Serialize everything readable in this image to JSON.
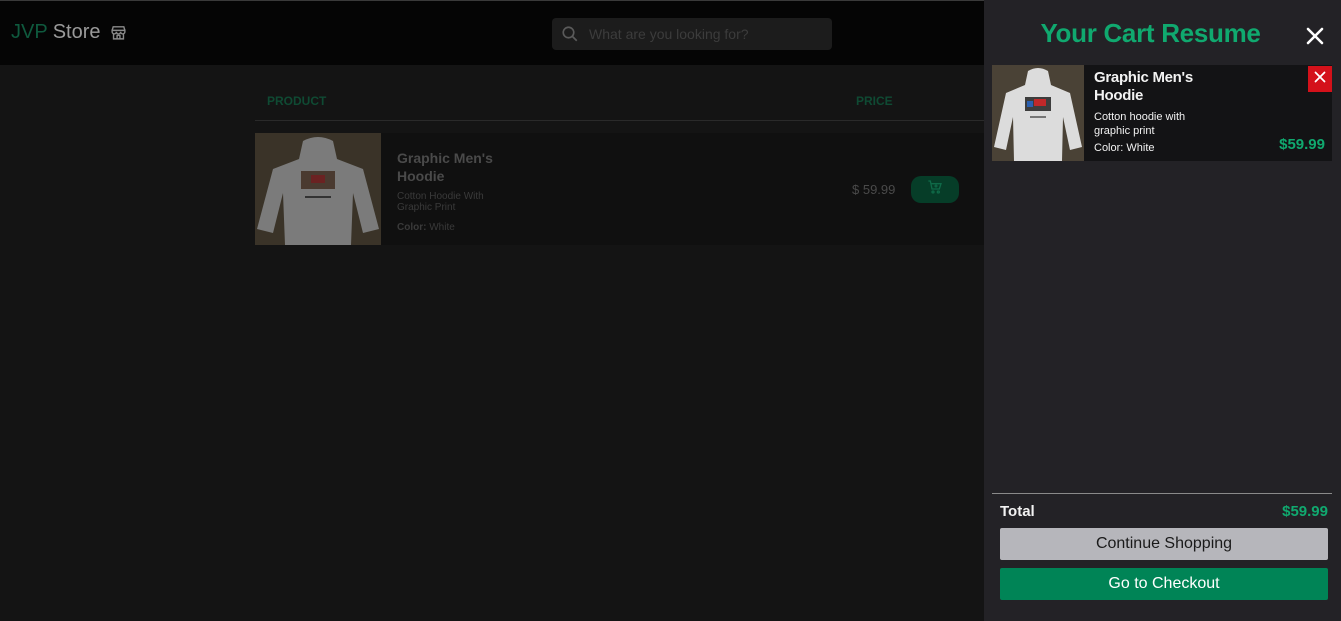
{
  "header": {
    "logo_part1": "JVP",
    "logo_part2": "Store",
    "logo_icon": "storefront-icon",
    "search_placeholder": "What are you looking for?",
    "search_icon": "search-icon"
  },
  "table": {
    "headers": {
      "product": "PRODUCT",
      "price": "PRICE"
    },
    "rows": [
      {
        "name": "Graphic Men's Hoodie",
        "description": "Cotton Hoodie With Graphic Print",
        "color_label": "Color:",
        "color_value": "White",
        "price": "$ 59.99",
        "action_icon": "add-to-cart-icon"
      }
    ]
  },
  "cart": {
    "title": "Your Cart Resume",
    "close_icon": "close-icon",
    "items": [
      {
        "name": "Graphic Men's Hoodie",
        "description": "Cotton hoodie with graphic print",
        "color": "Color: White",
        "price": "$59.99",
        "remove_icon": "remove-icon"
      }
    ],
    "total_label": "Total",
    "total_value": "$59.99",
    "continue_label": "Continue Shopping",
    "checkout_label": "Go to Checkout"
  },
  "colors": {
    "accent": "#10a96f",
    "checkout_button": "#008456",
    "remove_button": "#d4111a",
    "drawer_bg": "#232226",
    "overlay_bg": "#141414"
  }
}
